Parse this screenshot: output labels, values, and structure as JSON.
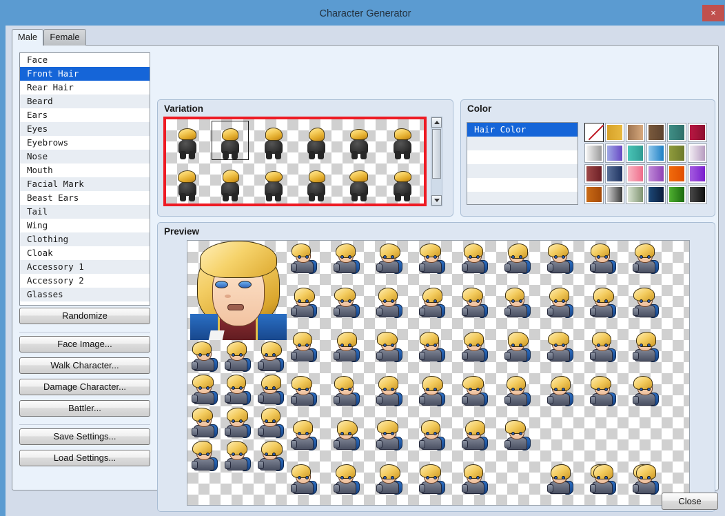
{
  "window": {
    "title": "Character Generator",
    "close_icon": "close-x-icon",
    "close_label": "×"
  },
  "tabs": [
    {
      "label": "Male",
      "active": true
    },
    {
      "label": "Female",
      "active": false
    }
  ],
  "parts_list": {
    "selected": "Front Hair",
    "items": [
      "Face",
      "Front Hair",
      "Rear Hair",
      "Beard",
      "Ears",
      "Eyes",
      "Eyebrows",
      "Nose",
      "Mouth",
      "Facial Mark",
      "Beast Ears",
      "Tail",
      "Wing",
      "Clothing",
      "Cloak",
      "Accessory 1",
      "Accessory 2",
      "Glasses"
    ]
  },
  "left_buttons": {
    "groups": [
      [
        "Randomize"
      ],
      [
        "Face Image...",
        "Walk Character...",
        "Damage Character...",
        "Battler..."
      ],
      [
        "Save Settings...",
        "Load Settings..."
      ]
    ]
  },
  "variation": {
    "title": "Variation",
    "highlight_color": "#ee1b24",
    "selected_index": 1,
    "columns": 6,
    "rows": 2,
    "cells": [
      {
        "hair_style": "swoop-left"
      },
      {
        "hair_style": "side-part"
      },
      {
        "hair_style": "short-bangs"
      },
      {
        "hair_style": "spiky-tuft"
      },
      {
        "hair_style": "bowl-round"
      },
      {
        "hair_style": "messy-front"
      },
      {
        "hair_style": "messy-back"
      },
      {
        "hair_style": "parted-long"
      },
      {
        "hair_style": "rounded-bob"
      },
      {
        "hair_style": "swept-curl"
      },
      {
        "hair_style": "ponytail"
      },
      {
        "hair_style": "short-flat"
      }
    ],
    "scrollbar": {
      "up_icon": "triangle-up-icon",
      "down_icon": "triangle-down-icon",
      "thumb_position": "top"
    }
  },
  "color": {
    "title": "Color",
    "list": {
      "selected": "Hair Color",
      "items": [
        "Hair Color",
        "",
        "",
        "",
        "",
        ""
      ]
    },
    "swatches": [
      {
        "name": "none",
        "from": "#ffffff",
        "to": "#ffffff",
        "none": true
      },
      {
        "name": "gold",
        "from": "#d7a22a",
        "to": "#e8b93f"
      },
      {
        "name": "tan",
        "from": "#9e7450",
        "to": "#d7a97e"
      },
      {
        "name": "brown",
        "from": "#7a5a3c",
        "to": "#5d4330"
      },
      {
        "name": "teal",
        "from": "#3f8e85",
        "to": "#2e6f6a"
      },
      {
        "name": "crimson",
        "from": "#b81742",
        "to": "#8e0f30"
      },
      {
        "name": "silver",
        "from": "#f2f2f2",
        "to": "#9a9a9a"
      },
      {
        "name": "periwinkle",
        "from": "#9fa8e6",
        "to": "#6848c4"
      },
      {
        "name": "turquoise",
        "from": "#49c4b6",
        "to": "#2f9c94"
      },
      {
        "name": "sky-blue",
        "from": "#8fc7ec",
        "to": "#1d7fc4"
      },
      {
        "name": "olive",
        "from": "#8f9b3c",
        "to": "#6d7a2c"
      },
      {
        "name": "lavender",
        "from": "#f0eaf2",
        "to": "#b79cc0"
      },
      {
        "name": "wine",
        "from": "#9e4848",
        "to": "#6d1f26"
      },
      {
        "name": "navy",
        "from": "#5a7099",
        "to": "#1e3360"
      },
      {
        "name": "pink",
        "from": "#f9b6c2",
        "to": "#ef6d8b"
      },
      {
        "name": "orchid",
        "from": "#c08ad8",
        "to": "#8e43b6"
      },
      {
        "name": "orange",
        "from": "#f06a0c",
        "to": "#e04f00"
      },
      {
        "name": "violet",
        "from": "#a45ce0",
        "to": "#7a1fcd"
      },
      {
        "name": "copper",
        "from": "#c96a16",
        "to": "#a54a08"
      },
      {
        "name": "gray",
        "from": "#d0d0d0",
        "to": "#3b3b3b"
      },
      {
        "name": "sage",
        "from": "#d9e3d1",
        "to": "#7f9472"
      },
      {
        "name": "midnight",
        "from": "#1d4a79",
        "to": "#0b1c3b"
      },
      {
        "name": "green",
        "from": "#4fb030",
        "to": "#1b6a10"
      },
      {
        "name": "black",
        "from": "#4a4a4a",
        "to": "#101010"
      }
    ]
  },
  "preview": {
    "title": "Preview",
    "face_portrait": {
      "name": "face-portrait",
      "hair": "blonde",
      "eyes": "blue",
      "outfit": "blue-knight"
    },
    "walk_sprites": {
      "columns": 3,
      "rows": 4,
      "directions": [
        "down",
        "left",
        "right",
        "up"
      ]
    },
    "battler_sprites": {
      "columns": 9,
      "rows": 6
    }
  },
  "footer": {
    "close_label": "Close"
  }
}
